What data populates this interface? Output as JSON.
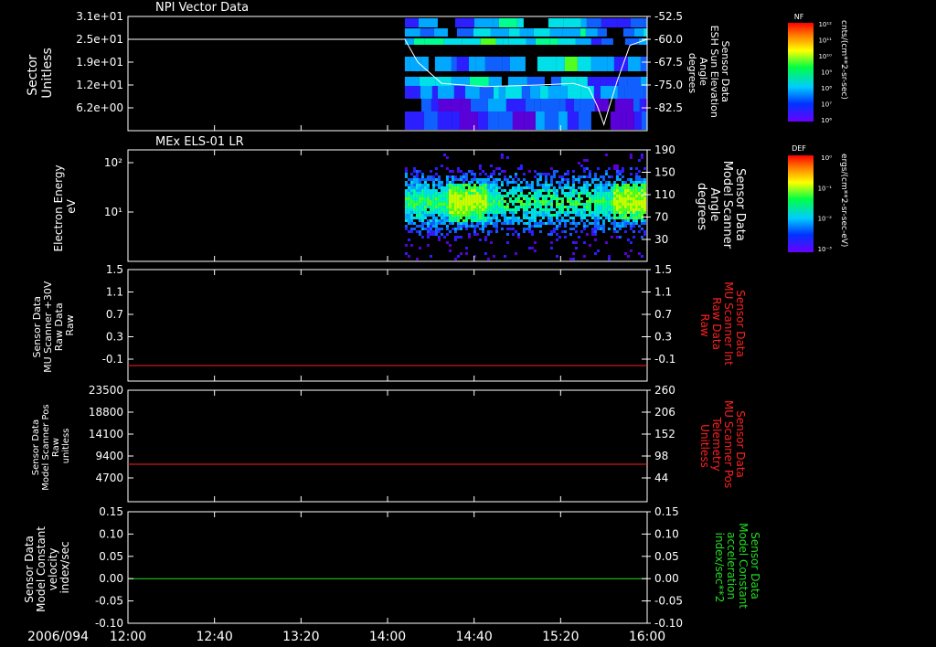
{
  "date_label": "2006/094",
  "x_axis": {
    "ticks": [
      "12:00",
      "12:40",
      "13:20",
      "14:00",
      "14:40",
      "15:20",
      "16:00"
    ]
  },
  "colors": {
    "axis": "#ffffff",
    "red": "#ff2020",
    "green": "#22dd22",
    "background": "#000000"
  },
  "colorbars": [
    {
      "label": "NF",
      "unit": "cnts/(cm**2-sr-sec)",
      "ticks": [
        "10¹²",
        "10¹¹",
        "10¹⁰",
        "10⁹",
        "10⁸",
        "10⁷",
        "10⁶"
      ]
    },
    {
      "label": "DEF",
      "unit": "ergs/(cm**2-sr-sec-eV)",
      "ticks": [
        "10⁰",
        "10⁻¹",
        "10⁻²",
        "10⁻³"
      ]
    }
  ],
  "chart_data": [
    {
      "type": "heatmap",
      "title": "NPI Vector Data",
      "ylabel": [
        "Sector",
        "Unitless"
      ],
      "yticks": [
        "3.1e+01",
        "2.5e+01",
        "1.9e+01",
        "1.2e+01",
        "6.2e+00"
      ],
      "ylim": [
        0,
        31
      ],
      "ylabel_right": [
        "Sensor Data",
        "ESH Sun Elevation",
        "Angle",
        "degrees"
      ],
      "yticks_right": [
        "-52.5",
        "-60.0",
        "-67.5",
        "-75.0",
        "-82.5"
      ],
      "data_start": "14:08",
      "overlay_line": {
        "color": "#ffffff",
        "x": [
          "12:00",
          "14:08",
          "14:14",
          "14:25",
          "14:45",
          "15:10",
          "15:26",
          "15:33",
          "15:37",
          "15:40",
          "15:46",
          "15:52",
          "16:00"
        ],
        "y": [
          -60.0,
          -60.0,
          -67.5,
          -74.5,
          -75.5,
          -75.0,
          -74.5,
          -76.0,
          -82.0,
          -88.0,
          -74.0,
          -62.0,
          -60.0
        ]
      }
    },
    {
      "type": "heatmap",
      "title": "MEx ELS-01 LR",
      "ylabel": [
        "Electron Energy",
        "eV"
      ],
      "yticks": [
        "10²",
        "10¹"
      ],
      "yscale": "log",
      "ylabel_right": [
        "Sensor Data",
        "Model Scanner",
        "Angle",
        "degrees"
      ],
      "yticks_right": [
        "190",
        "150",
        "110",
        "70",
        "30"
      ],
      "data_start": "14:08"
    },
    {
      "type": "line",
      "ylabel": [
        "Sensor Data",
        "MU Scanner +30V",
        "Raw Data",
        "Raw"
      ],
      "yticks": [
        "1.5",
        "1.1",
        "0.7",
        "0.3",
        "-0.1"
      ],
      "ylim": [
        -0.3,
        1.5
      ],
      "ylabel_right": [
        "Sensor Data",
        "MU Scanner Int",
        "Raw Data",
        "Raw"
      ],
      "yticks_right": [
        "1.5",
        "1.1",
        "0.7",
        "0.3",
        "-0.1"
      ],
      "series": [
        {
          "color": "#ff2020",
          "x": [
            "12:00",
            "16:00"
          ],
          "y": [
            -0.05,
            -0.05
          ]
        }
      ]
    },
    {
      "type": "line",
      "ylabel": [
        "Sensor Data",
        "Model Scanner Pos",
        "Raw",
        "unitless"
      ],
      "yticks": [
        "23500",
        "18800",
        "14100",
        "9400",
        "4700"
      ],
      "ylim": [
        0,
        23500
      ],
      "ylabel_right": [
        "Sensor Data",
        "MU Scanner Pos",
        "Telemetry",
        "Unitless"
      ],
      "yticks_right": [
        "260",
        "206",
        "152",
        "98",
        "44"
      ],
      "series": [
        {
          "color": "#ff2020",
          "x": [
            "12:00",
            "16:00"
          ],
          "y": [
            7900,
            7900
          ]
        }
      ]
    },
    {
      "type": "line",
      "ylabel": [
        "Sensor Data",
        "Model Constant",
        "velocity",
        "index/sec"
      ],
      "yticks": [
        "0.15",
        "0.10",
        "0.05",
        "0.00",
        "-0.05",
        "-0.10"
      ],
      "ylim": [
        -0.1,
        0.15
      ],
      "ylabel_right": [
        "Sensor Data",
        "Model Constant",
        "acceleration",
        "index/sec**2"
      ],
      "yticks_right": [
        "0.15",
        "0.10",
        "0.05",
        "0.00",
        "-0.05",
        "-0.10"
      ],
      "series": [
        {
          "color": "#22dd22",
          "x": [
            "12:00",
            "16:00"
          ],
          "y": [
            0.0,
            0.0
          ]
        }
      ]
    }
  ]
}
